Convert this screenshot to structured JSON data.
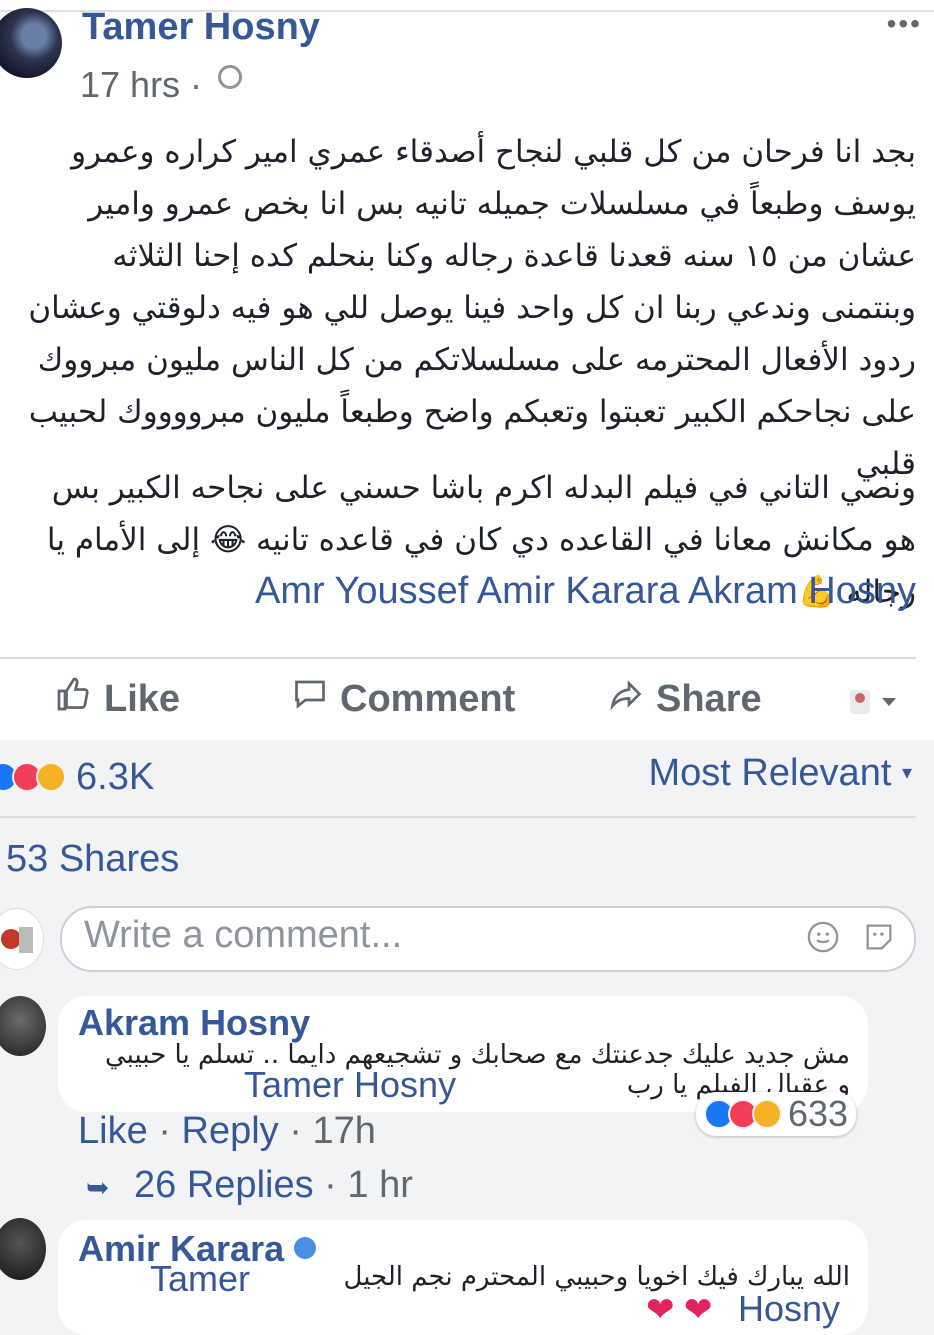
{
  "post": {
    "author": "Tamer Hosny",
    "time": "17 hrs · ",
    "more": "•••",
    "paragraph1": "بجد انا فرحان من كل قلبي لنجاح أصدقاء عمري امير كراره وعمرو يوسف وطبعاً في مسلسلات جميله تانيه بس انا بخص عمرو وامير عشان من ١٥ سنه قعدنا قاعدة رجاله وكنا بنحلم كده إحنا الثلاثه وبنتمنى وندعي ربنا ان كل واحد فينا يوصل للي هو فيه دلوقتي وعشان ردود الأفعال المحترمه على مسلسلاتكم من كل الناس مليون مبرووك على نجاحكم الكبير تعبتوا وتعبكم واضح وطبعاً مليون مبرووووك لحبيب قلبي",
    "paragraph2": "ونصي التاني في فيلم البدله اكرم باشا حسني على نجاحه الكبير بس هو مكانش معانا في القاعده دي كان في قاعده تانيه 😂 إلى الأمام يا رجاله 💪",
    "tags": "Amr Youssef Amir Karara Akram Hosny"
  },
  "actions": {
    "like": "Like",
    "comment": "Comment",
    "share": "Share"
  },
  "reactions": {
    "count": "6.3K",
    "sort": "Most Relevant"
  },
  "shares": "53 Shares",
  "composer": {
    "placeholder": "Write a comment..."
  },
  "comments": [
    {
      "name": "Akram Hosny",
      "text": "مش جديد عليك جدعنتك مع صحابك و تشجيعهم دايما .. تسلم يا حبيبي و عقبال الفيلم يا رب",
      "link": "Tamer Hosny",
      "reactions": "633",
      "like": "Like",
      "reply": "Reply",
      "time": "17h",
      "replies": "26 Replies",
      "replies_time": "1 hr"
    },
    {
      "name": "Amir Karara",
      "text": "الله يبارك فيك اخويا وحبيبي المحترم نجم الجيل",
      "link1": "Tamer",
      "link2": "Hosny",
      "hearts": "❤ ❤"
    }
  ]
}
